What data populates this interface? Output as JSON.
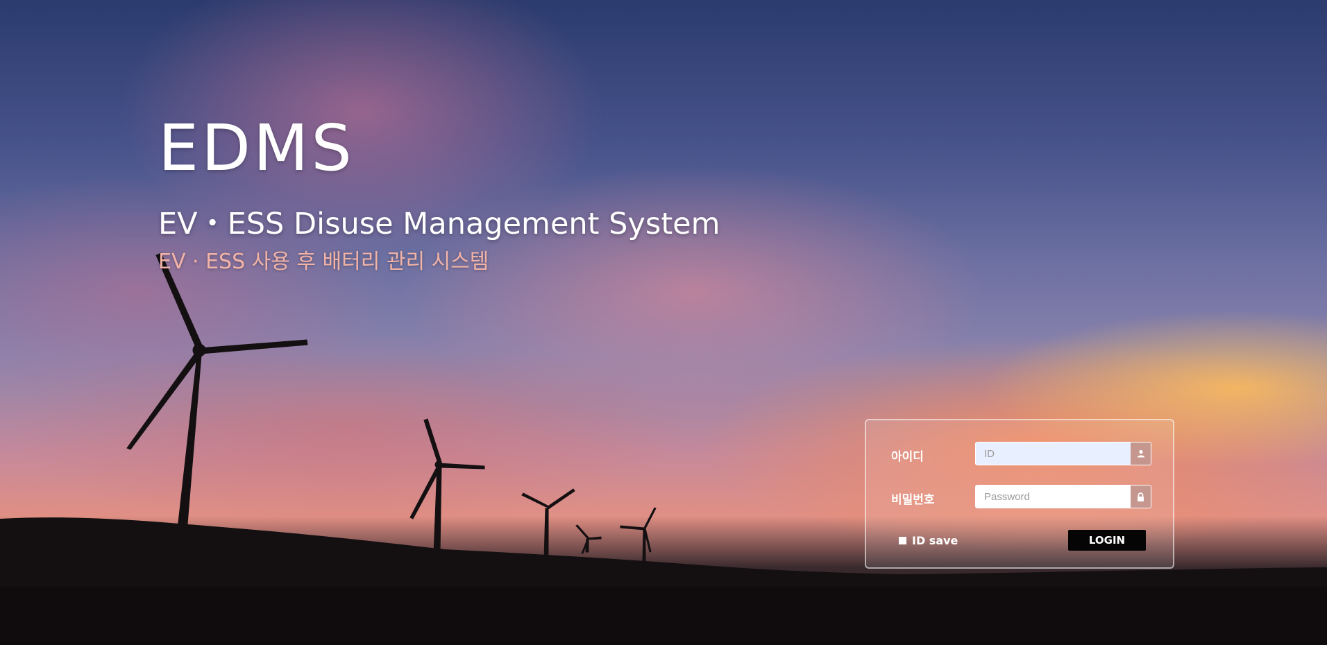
{
  "brand": {
    "title": "EDMS",
    "subtitle": "EV・ESS Disuse Management System",
    "subtitle_ko": "EV · ESS 사용 후 배터리 관리 시스템"
  },
  "login": {
    "id_label": "아이디",
    "id_placeholder": "ID",
    "password_label": "비밀번호",
    "password_placeholder": "Password",
    "save_label": "ID save",
    "login_button": "LOGIN"
  },
  "icons": {
    "id_addon": "user-icon",
    "password_addon": "lock-icon"
  },
  "colors": {
    "subtitle_ko": "#f2b3a7",
    "login_button": "#050505"
  }
}
